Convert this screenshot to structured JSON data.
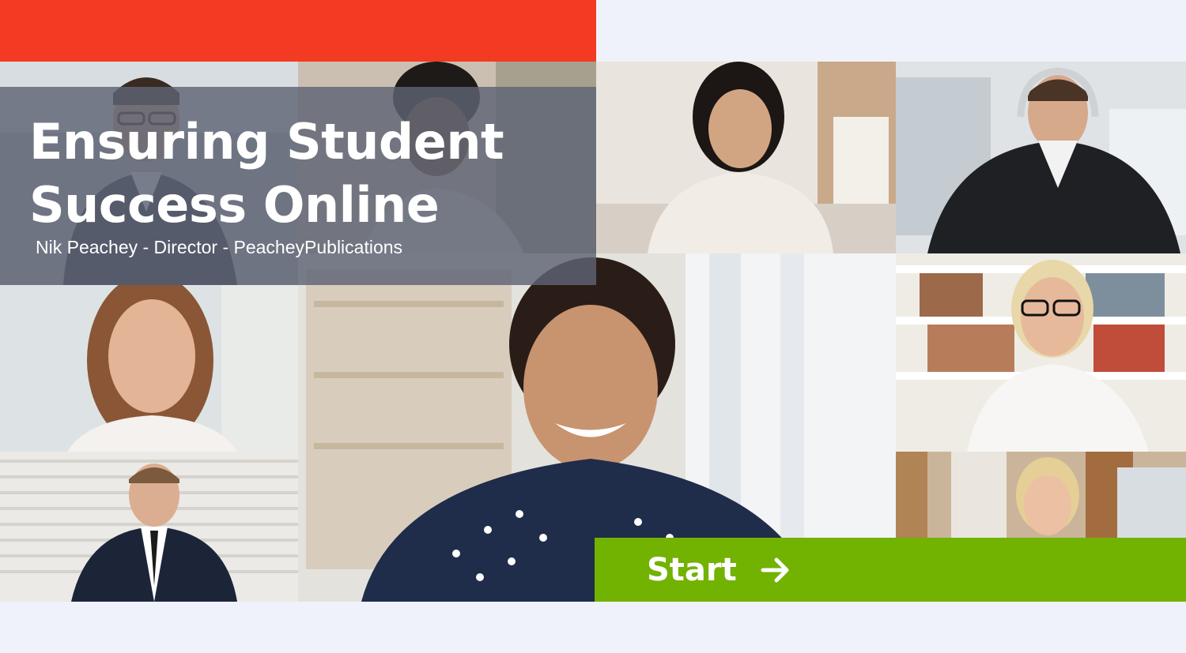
{
  "slide": {
    "title_line_1": "Ensuring Student",
    "title_line_2": "Success Online",
    "subtitle": "Nik Peachey - Director - PeacheyPublications",
    "start_label": "Start"
  },
  "colors": {
    "accent_red": "#f33a22",
    "start_green": "#72b200",
    "overlay": "#5e6474",
    "background": "#eff2fb"
  },
  "icons": {
    "start": "arrow-right-icon"
  }
}
